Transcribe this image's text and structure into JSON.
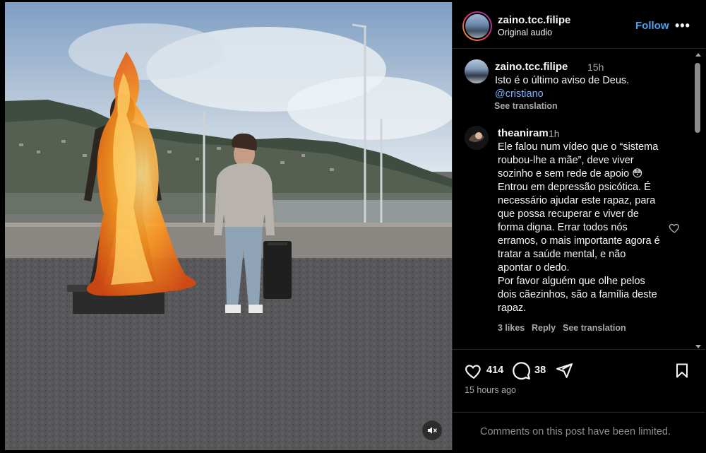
{
  "post": {
    "username": "zaino.tcc.filipe",
    "audio": "Original audio",
    "follow_label": "Follow",
    "more_label": "•••"
  },
  "caption": {
    "username": "zaino.tcc.filipe",
    "time": "15h",
    "text": "Isto é o último aviso de Deus.",
    "mention": "@cristiano",
    "see_translation": "See translation"
  },
  "comment": {
    "username": "theaniram",
    "time": "1h",
    "lines": [
      "Ele falou num vídeo que o “sistema",
      "roubou-lhe a mãe”, deve viver",
      "sozinho e sem rede de apoio 😳",
      "Entrou em depressão psicótica. É",
      "necessário ajudar este rapaz, para",
      "que possa recuperar e viver de",
      "forma digna. Errar todos nós",
      "erramos, o mais importante agora é",
      "tratar a saúde mental, e não",
      "apontar o dedo.",
      "Por favor alguém que olhe pelos",
      "dois cãezinhos, são a família deste",
      "rapaz."
    ],
    "likes": "3 likes",
    "reply": "Reply",
    "see_translation": "See translation"
  },
  "actions": {
    "likes_count": "414",
    "comments_count": "38",
    "posted_ago": "15 hours ago"
  },
  "footer": {
    "limited_text": "Comments on this post have been limited."
  },
  "icons": {
    "like": "heart-icon",
    "comment": "comment-bubble-icon",
    "share": "paper-plane-icon",
    "save": "bookmark-icon",
    "mute": "speaker-muted-icon",
    "comment_like": "heart-icon"
  },
  "colors": {
    "background": "#000000",
    "link": "#4aa3f0",
    "mention": "#7ab3ff",
    "secondary_text": "#a8a8a8"
  }
}
